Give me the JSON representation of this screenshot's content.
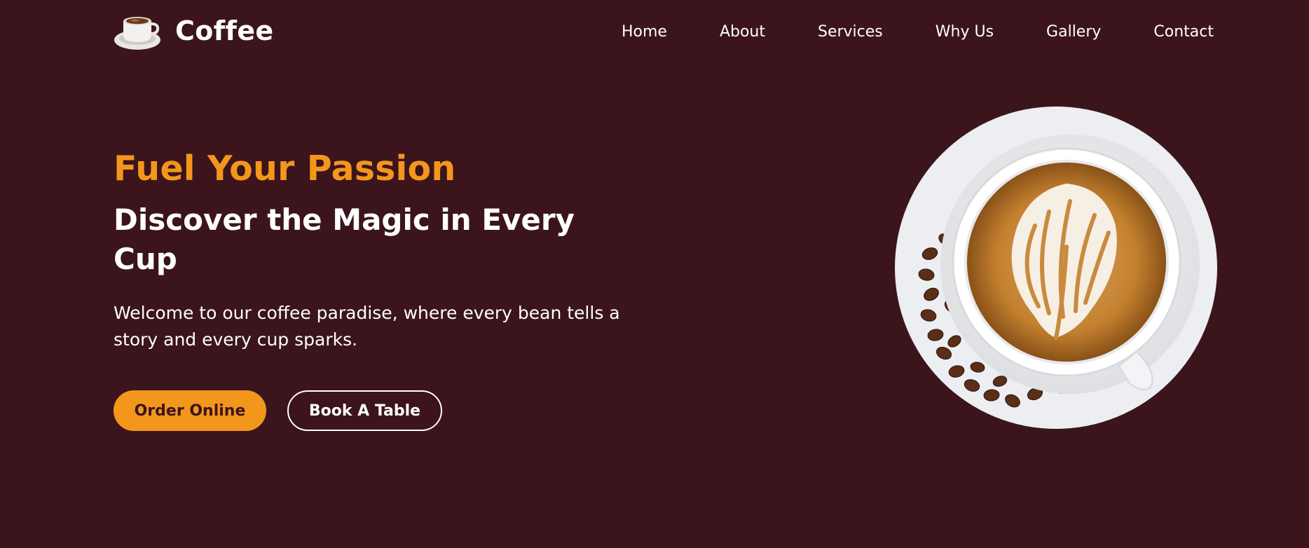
{
  "header": {
    "brand_name": "Coffee",
    "logo_icon": "coffee-cup-icon"
  },
  "nav": {
    "items": [
      {
        "label": "Home"
      },
      {
        "label": "About"
      },
      {
        "label": "Services"
      },
      {
        "label": "Why Us"
      },
      {
        "label": "Gallery"
      },
      {
        "label": "Contact"
      }
    ]
  },
  "hero": {
    "title": "Fuel Your Passion",
    "subtitle": "Discover the Magic in Every Cup",
    "description": "Welcome to our coffee paradise, where every bean tells a story and every cup sparks.",
    "primary_button": "Order Online",
    "secondary_button": "Book A Table",
    "image": "latte-art-coffee-cup-image"
  },
  "colors": {
    "background": "#3b141c",
    "accent": "#f3961c",
    "text": "#ffffff"
  }
}
